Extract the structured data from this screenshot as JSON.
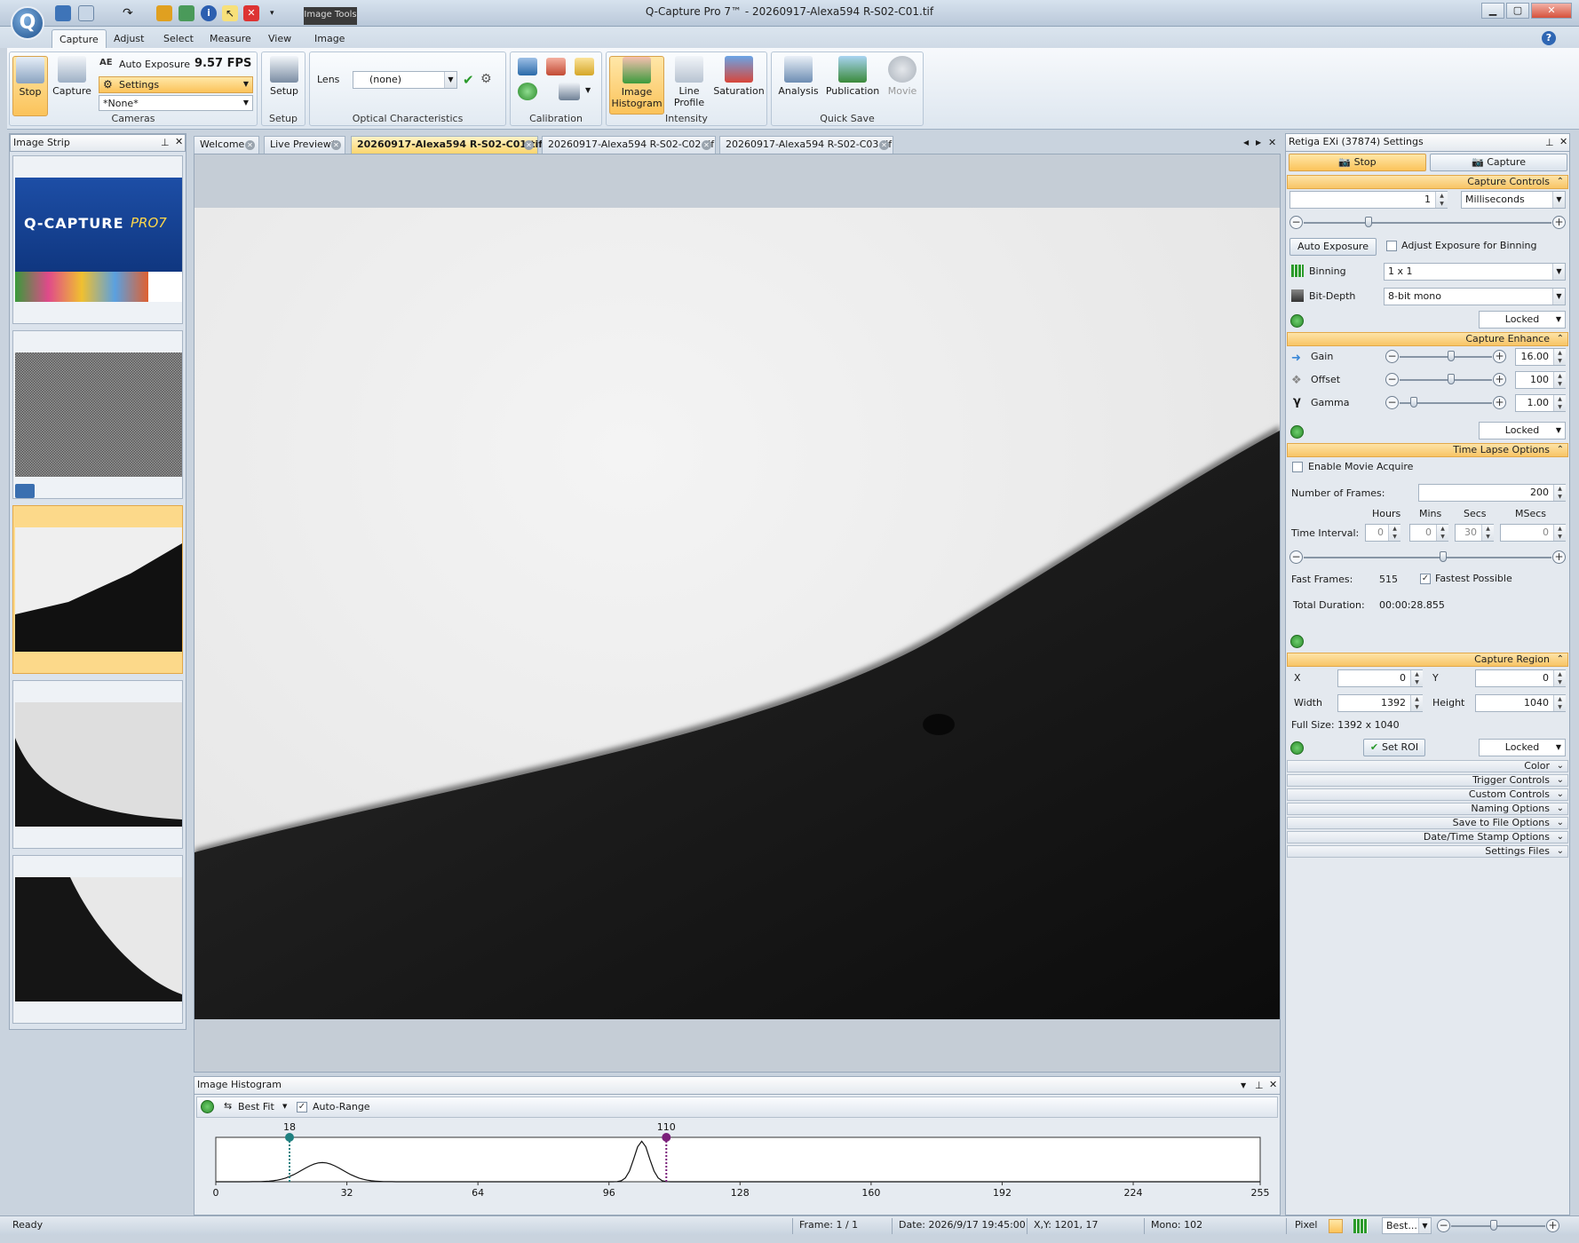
{
  "window": {
    "title": "Q-Capture Pro 7™ - 20260917-Alexa594 R-S02-C01.tif",
    "context_tab": "Image Tools",
    "minimize": "▁",
    "maximize": "▢",
    "close": "✕"
  },
  "ribbon_tabs": [
    "Capture",
    "Adjust",
    "Select",
    "Measure",
    "View",
    "Image"
  ],
  "ribbon": {
    "cameras": {
      "stop": "Stop",
      "capture": "Capture",
      "auto_exposure": "Auto Exposure",
      "ae_badge": "AE",
      "fps": "9.57 FPS",
      "settings": "Settings",
      "preset": "*None*",
      "label": "Cameras"
    },
    "setup": {
      "button": "Setup",
      "label": "Setup"
    },
    "optical": {
      "lens_label": "Lens",
      "lens_value": "(none)",
      "label": "Optical Characteristics"
    },
    "calibration": {
      "label": "Calibration"
    },
    "intensity": {
      "histogram": "Image Histogram",
      "line_profile": "Line Profile",
      "saturation": "Saturation",
      "label": "Intensity"
    },
    "quick_save": {
      "analysis": "Analysis",
      "publication": "Publication",
      "movie": "Movie",
      "label": "Quick Save"
    }
  },
  "image_strip": {
    "title": "Image Strip",
    "logo_text": "Q-CAPTURE",
    "logo_pro": "PRO7"
  },
  "doc_tabs": [
    "Welcome",
    "Live Preview*",
    "20260917-Alexa594 R-S02-C01.tif",
    "20260917-Alexa594 R-S02-C02.tif",
    "20260917-Alexa594 R-S02-C03.tif"
  ],
  "settings_panel": {
    "title": "Retiga EXi (37874) Settings",
    "stop": "Stop",
    "capture": "Capture",
    "capture_controls": {
      "title": "Capture Controls",
      "exposure_value": "1",
      "exposure_unit": "Milliseconds",
      "auto_exposure": "Auto Exposure",
      "adjust_binning": "Adjust Exposure for Binning",
      "binning_label": "Binning",
      "binning_value": "1 x 1",
      "bitdepth_label": "Bit-Depth",
      "bitdepth_value": "8-bit mono",
      "locked": "Locked"
    },
    "capture_enhance": {
      "title": "Capture Enhance",
      "gain_label": "Gain",
      "gain_value": "16.00",
      "offset_label": "Offset",
      "offset_value": "100",
      "gamma_label": "Gamma",
      "gamma_value": "1.00",
      "locked": "Locked"
    },
    "time_lapse": {
      "title": "Time Lapse Options",
      "enable_movie": "Enable Movie Acquire",
      "frames_label": "Number of Frames:",
      "frames_value": "200",
      "hours": "Hours",
      "mins": "Mins",
      "secs": "Secs",
      "msecs": "MSecs",
      "interval_label": "Time Interval:",
      "h": "0",
      "m": "0",
      "s": "30",
      "ms": "0",
      "fast_frames_label": "Fast Frames:",
      "fast_frames_value": "515",
      "fastest": "Fastest Possible",
      "total_label": "Total Duration:",
      "total_value": "00:00:28.855"
    },
    "capture_region": {
      "title": "Capture Region",
      "x_label": "X",
      "x_value": "0",
      "y_label": "Y",
      "y_value": "0",
      "width_label": "Width",
      "width_value": "1392",
      "height_label": "Height",
      "height_value": "1040",
      "full_size": "Full Size: 1392 x 1040",
      "set_roi": "Set ROI",
      "locked": "Locked"
    },
    "collapsed": [
      "Color",
      "Trigger Controls",
      "Custom Controls",
      "Naming Options",
      "Save to File Options",
      "Date/Time Stamp Options",
      "Settings Files"
    ]
  },
  "histogram": {
    "title": "Image Histogram",
    "best_fit": "Best Fit",
    "auto_range": "Auto-Range",
    "min_marker": "18",
    "max_marker": "110",
    "ticks": [
      "0",
      "32",
      "64",
      "96",
      "128",
      "160",
      "192",
      "224",
      "255"
    ]
  },
  "status": {
    "ready": "Ready",
    "frame": "Frame: 1 / 1",
    "date": "Date: 2026/9/17 19:45:00",
    "xy": "X,Y: 1201,   17",
    "mono": "Mono:   102",
    "pixel": "Pixel",
    "zoom": "Best..."
  }
}
